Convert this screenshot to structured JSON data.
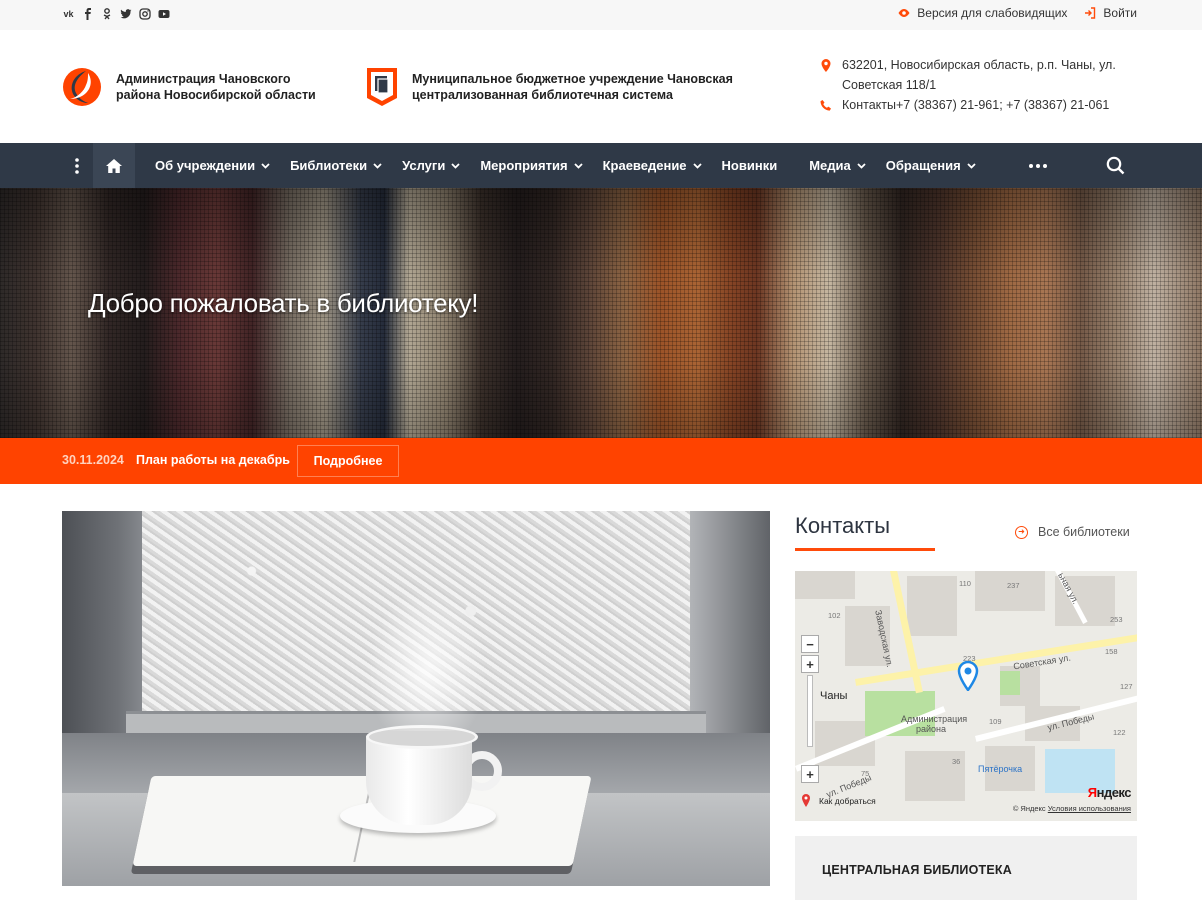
{
  "topbar": {
    "social": [
      "vk",
      "facebook",
      "odnoklassniki",
      "twitter",
      "instagram",
      "youtube"
    ],
    "social_labels": {
      "vk": "vk"
    },
    "low_vision_label": "Версия для слабовидящих",
    "login_label": "Войти"
  },
  "header": {
    "admin_name": "Администрация Чановского района Новосибирской области",
    "library_name": "Муниципальное бюджетное учреждение Чановская централизованная библиотечная система",
    "address": "632201, Новосибирская область, р.п. Чаны, ул. Советская 118/1",
    "contacts": "Контакты+7 (38367) 21-961; +7 (38367) 21-061"
  },
  "nav": {
    "items": [
      {
        "label": "Об учреждении",
        "dropdown": true
      },
      {
        "label": "Библиотеки",
        "dropdown": true
      },
      {
        "label": "Услуги",
        "dropdown": true
      },
      {
        "label": "Мероприятия",
        "dropdown": true
      },
      {
        "label": "Краеведение",
        "dropdown": true
      },
      {
        "label": "Новинки",
        "dropdown": false
      },
      {
        "label": "Медиа",
        "dropdown": true
      },
      {
        "label": "Обращения",
        "dropdown": true
      }
    ]
  },
  "hero": {
    "title": "Добро пожаловать в библиотеку!"
  },
  "ticker": {
    "date": "30.11.2024",
    "title": "План работы на декабрь",
    "button": "Подробнее"
  },
  "sidebar": {
    "title": "Контакты",
    "all_libraries": "Все библиотеки",
    "library_title": "ЦЕНТРАЛЬНАЯ БИБЛИОТЕКА"
  },
  "map": {
    "labels": {
      "town": "Чаны",
      "street_sovetskaya": "Советская ул.",
      "street_zavodskaya": "Заводская ул.",
      "street_pobedy1": "ул. Победы",
      "street_pobedy2": "ул. Победы",
      "street_top_right": "ьная ул.",
      "admin": "Администрация района",
      "shop": "Пятёрочка"
    },
    "numbers": [
      "110",
      "237",
      "102",
      "253",
      "223",
      "158",
      "127",
      "109",
      "36",
      "75",
      "122"
    ],
    "route_label": "Как добраться",
    "copyright": "© Яндекс",
    "terms": "Условия использования",
    "brand": "Яндекс"
  },
  "colors": {
    "accent": "#ff4300",
    "nav_bg": "#2f3947"
  }
}
